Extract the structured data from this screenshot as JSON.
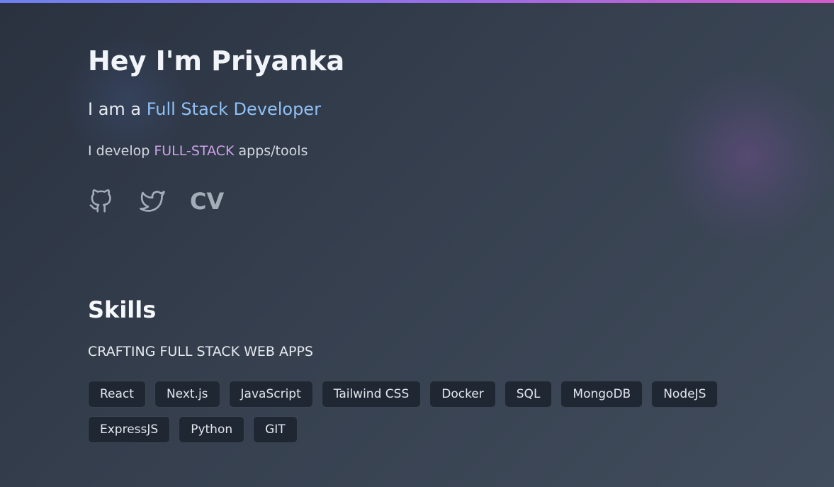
{
  "hero": {
    "title": "Hey I'm Priyanka",
    "subtitle_prefix": "I am a ",
    "subtitle_highlight": "Full Stack Developer",
    "tagline_prefix": "I develop ",
    "tagline_highlight": "FULL-STACK",
    "tagline_suffix": " apps/tools"
  },
  "social": {
    "github_icon": "github-icon",
    "twitter_icon": "twitter-icon",
    "cv_label": "CV"
  },
  "skills": {
    "title": "Skills",
    "subtitle": "CRAFTING FULL STACK WEB APPS",
    "tags": [
      "React",
      "Next.js",
      "JavaScript",
      "Tailwind CSS",
      "Docker",
      "SQL",
      "MongoDB",
      "NodeJS",
      "ExpressJS",
      "Python",
      "GIT"
    ]
  },
  "colors": {
    "accent_blue": "#8fc0f5",
    "accent_purple": "#cfa2ea",
    "top_bar_gradient": [
      "#6f80f0",
      "#9a6de8",
      "#d45cc8"
    ]
  }
}
